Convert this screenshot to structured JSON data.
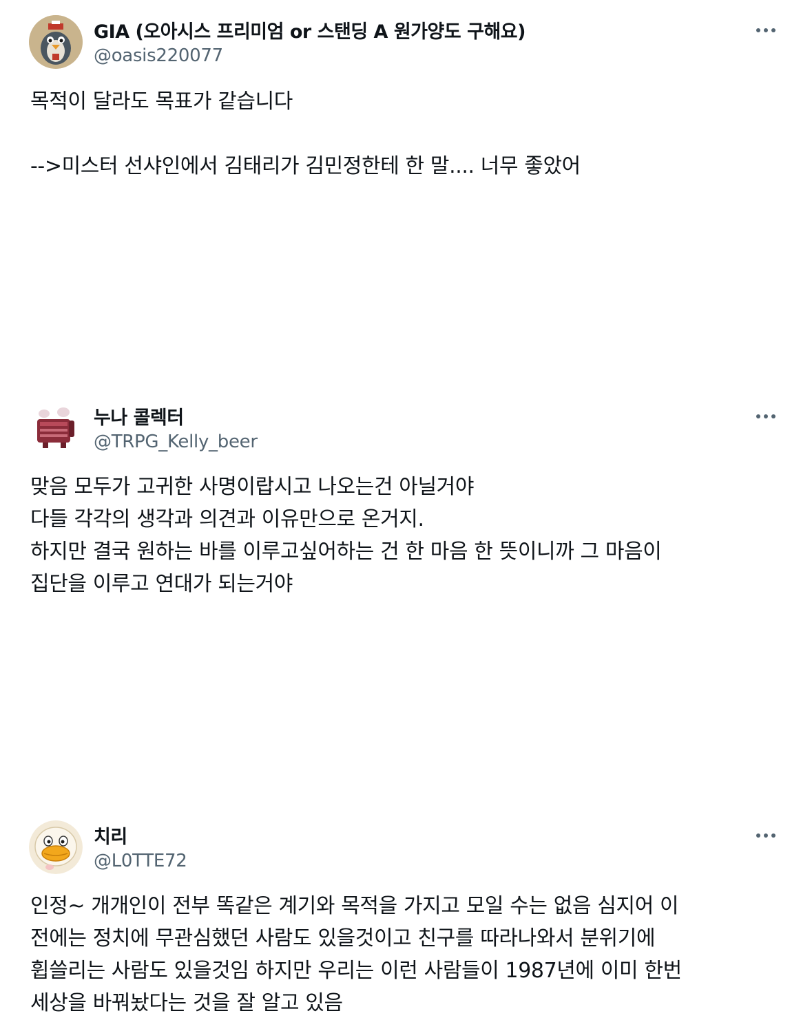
{
  "tweets": [
    {
      "display_name": "GIA (오아시스 프리미엄 or 스탠딩 A 원가양도 구해요)",
      "handle": "@oasis220077",
      "avatar_icon": "penguin-avatar-icon",
      "more_icon": "more-options-icon",
      "lines": [
        "목적이 달라도 목표가 같습니다",
        "",
        "-->미스터 선샤인에서 김태리가 김민정한테 한 말.... 너무 좋았어"
      ]
    },
    {
      "display_name": "누나 콜렉터",
      "handle": "@TRPG_Kelly_beer",
      "avatar_icon": "character-avatar-icon",
      "more_icon": "more-options-icon",
      "lines": [
        "맞음 모두가 고귀한 사명이랍시고 나오는건 아닐거야",
        "다들 각각의 생각과 의견과 이유만으로 온거지.",
        "하지만 결국 원하는 바를 이루고싶어하는 건 한 마음 한 뜻이니까 그 마음이",
        "집단을 이루고 연대가 되는거야"
      ]
    },
    {
      "display_name": "치리",
      "handle": "@L0TTE72",
      "avatar_icon": "duck-avatar-icon",
      "more_icon": "more-options-icon",
      "lines": [
        "인정~ 개개인이 전부 똑같은 계기와 목적을 가지고 모일 수는 없음 심지어 이",
        "전에는 정치에 무관심했던 사람도 있을것이고 친구를 따라나와서 분위기에",
        "휩쓸리는 사람도 있을것임 하지만 우리는 이런 사람들이 1987년에 이미 한번",
        "세상을 바꿔놨다는 것을 잘 알고 있음"
      ]
    }
  ]
}
